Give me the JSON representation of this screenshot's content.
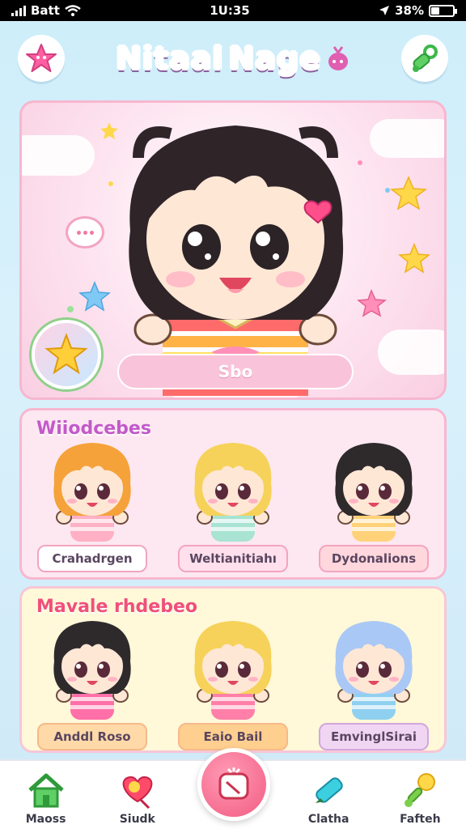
{
  "status": {
    "carrier": "Batt",
    "time": "1U:35",
    "battery": "38%",
    "battery_level": 0.38
  },
  "header": {
    "title_word1": "Nitaal",
    "title_word2": "Nage",
    "left_icon": "star-icon",
    "right_icon": "pacifier-icon"
  },
  "hero": {
    "name": "Sbo",
    "badge_icon": "star-icon"
  },
  "sections": [
    {
      "title": "Wiiodcebes",
      "characters": [
        {
          "label": "Crahadrgen",
          "hair": "#f5a23a",
          "shirt": "#ffb0c4"
        },
        {
          "label": "Weltianitiahı",
          "hair": "#f6d25a",
          "shirt": "#a9e3d2"
        },
        {
          "label": "Dydonalions",
          "hair": "#2e2a2c",
          "shirt": "#ffd27a"
        }
      ]
    },
    {
      "title": "Mavale rhdebeo",
      "characters": [
        {
          "label": "Anddl Roso",
          "hair": "#2e2a2c",
          "shirt": "#ff6fa8"
        },
        {
          "label": "Eaio Bail",
          "hair": "#f6d25a",
          "shirt": "#ff7fa8"
        },
        {
          "label": "EmvinglSirai",
          "hair": "#a9c8f5",
          "shirt": "#8fd0f0"
        }
      ]
    }
  ],
  "tabs": [
    {
      "label": "Maoss",
      "icon": "home-icon"
    },
    {
      "label": "Siudk",
      "icon": "heart-balloon-icon"
    },
    {
      "label": "Clatha",
      "icon": "marker-icon"
    },
    {
      "label": "Fafteh",
      "icon": "rattle-icon"
    }
  ],
  "center_tab_icon": "camera-icon"
}
